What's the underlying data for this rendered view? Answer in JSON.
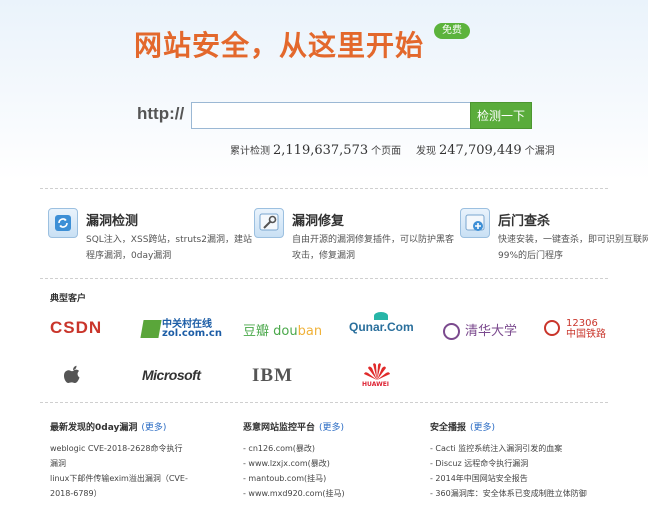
{
  "hero": {
    "headline": "网站安全，从这里开始",
    "badge": "免费",
    "protocol": "http://",
    "search_value": "",
    "search_button": "检测一下",
    "stats_left": {
      "prefix": "累计检测",
      "value": "2,119,637,573",
      "suffix": "个页面"
    },
    "stats_right": {
      "prefix": "发现",
      "value": "247,709,449",
      "suffix": "个漏洞"
    }
  },
  "features": [
    {
      "icon": "refresh-icon",
      "title": "漏洞检测",
      "desc": "SQL注入，XSS跨站，struts2漏洞，建站程序漏洞，0day漏洞"
    },
    {
      "icon": "wrench-icon",
      "title": "漏洞修复",
      "desc": "自由开源的漏洞修复插件，可以防护黑客攻击，修复漏洞"
    },
    {
      "icon": "shield-plus-icon",
      "title": "后门查杀",
      "desc": "快速安装，一键查杀，即可识别互联网99%的后门程序"
    }
  ],
  "customers": {
    "title": "典型客户",
    "logos": {
      "csdn": "CSDN",
      "zol_cn": "中关村在线",
      "zol_en": "zol.com.cn",
      "douban_cn": "豆瓣",
      "douban_en1": "dou",
      "douban_en2": "ban",
      "qunar": "Qunar.Com",
      "tsinghua": "清华大学",
      "r12306_num": "12306",
      "r12306_cn": "中国铁路",
      "microsoft": "Microsoft",
      "ibm": "IBM",
      "huawei": "HUAWEI"
    }
  },
  "columns": [
    {
      "title": "最新发现的0day漏洞",
      "more": "(更多)",
      "items": [
        "weblogic CVE-2018-2628命令执行漏洞",
        "linux下邮件传输exim溢出漏洞（CVE-2018-6789）"
      ]
    },
    {
      "title": "恶意网站监控平台",
      "more": "(更多)",
      "items": [
        "- cn126.com(暴改)",
        "- www.lzxjx.com(暴改)",
        "- mantoub.com(挂马)",
        "- www.mxd920.com(挂马)"
      ]
    },
    {
      "title": "安全播报",
      "more": "(更多)",
      "items": [
        "- Cacti 监控系统注入漏洞引发的血案",
        "- Discuz 远程命令执行漏洞",
        "- 2014年中国网站安全报告",
        "- 360漏洞库：安全体系已变成制胜立体防御"
      ]
    }
  ]
}
